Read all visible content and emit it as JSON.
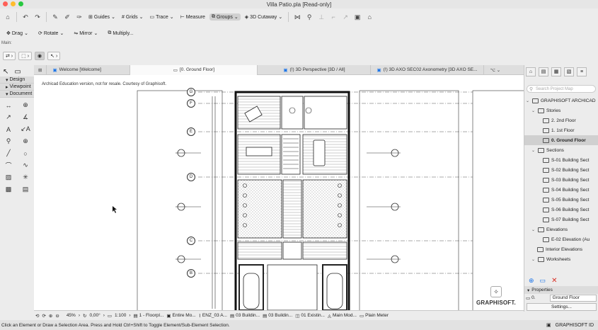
{
  "window": {
    "title": "Villa Patio.pla [Read-only]"
  },
  "toolbar": {
    "guides": "Guides",
    "grids": "Grids",
    "trace": "Trace",
    "measure": "Measure",
    "groups": "Groups",
    "cutaway": "3D Cutaway"
  },
  "edit_toolbar": {
    "drag": "Drag",
    "rotate": "Rotate",
    "mirror": "Mirror",
    "multiply": "Multiply..."
  },
  "main_label": "Main:",
  "palette": {
    "categories": [
      "Design",
      "Viewpoint",
      "Document"
    ]
  },
  "tabs": [
    {
      "label": "Welcome [Welcome]"
    },
    {
      "label": "[0. Ground Floor]"
    },
    {
      "label": "(!) 3D Perspective [3D / All]"
    },
    {
      "label": "(!) 3D AXO SEC02 Axonometry [3D AXO SE..."
    }
  ],
  "canvas": {
    "notice": "Archicad Education version, not for resale. Courtesy of Graphisoft.",
    "grid_labels": [
      "G",
      "F",
      "E",
      "D",
      "C",
      "B"
    ],
    "logo_text": "GRAPHISOFT."
  },
  "navigator": {
    "search_placeholder": "Search Project Map",
    "root": "GRAPHISOFT ARCHICAD",
    "stories_label": "Stories",
    "stories": [
      "2. 2nd Floor",
      "1. 1st Floor",
      "0. Ground Floor"
    ],
    "sections_label": "Sections",
    "sections": [
      "S-01 Building Sect",
      "S-02 Building Sect",
      "S-03 Building Sect",
      "S-04 Building Sect",
      "S-05 Building Sect",
      "S-06 Building Sect",
      "S-07 Building Sect"
    ],
    "elevations_label": "Elevations",
    "elevations": [
      "E-02 Elevation (Au"
    ],
    "interior_elevations": "Interior Elevations",
    "worksheets": "Worksheets"
  },
  "properties": {
    "header": "Properties",
    "id": "0.",
    "value": "Ground Floor",
    "settings": "Settings..."
  },
  "bottom_bar": {
    "zoom": "45%",
    "angle": "0,00°",
    "scale": "1:100",
    "layer": "1 - Floorpl...",
    "model": "Entire Mo...",
    "renov": "ENZ_03 A...",
    "b1": "03 Buildin...",
    "b2": "03 Buildin...",
    "b3": "01 Existin...",
    "b4": "Main Mod...",
    "b5": "Plain Meter"
  },
  "status": {
    "message": "Click an Element or Draw a Selection Area. Press and Hold Ctrl+Shift to Toggle Element/Sub-Element Selection.",
    "brand": "GRAPHISOFT ID"
  },
  "colors": {
    "close": "#ff5f57",
    "minimize": "#febc2e",
    "zoom": "#28c840",
    "accent": "#1a73e8",
    "delete": "#d93025"
  }
}
